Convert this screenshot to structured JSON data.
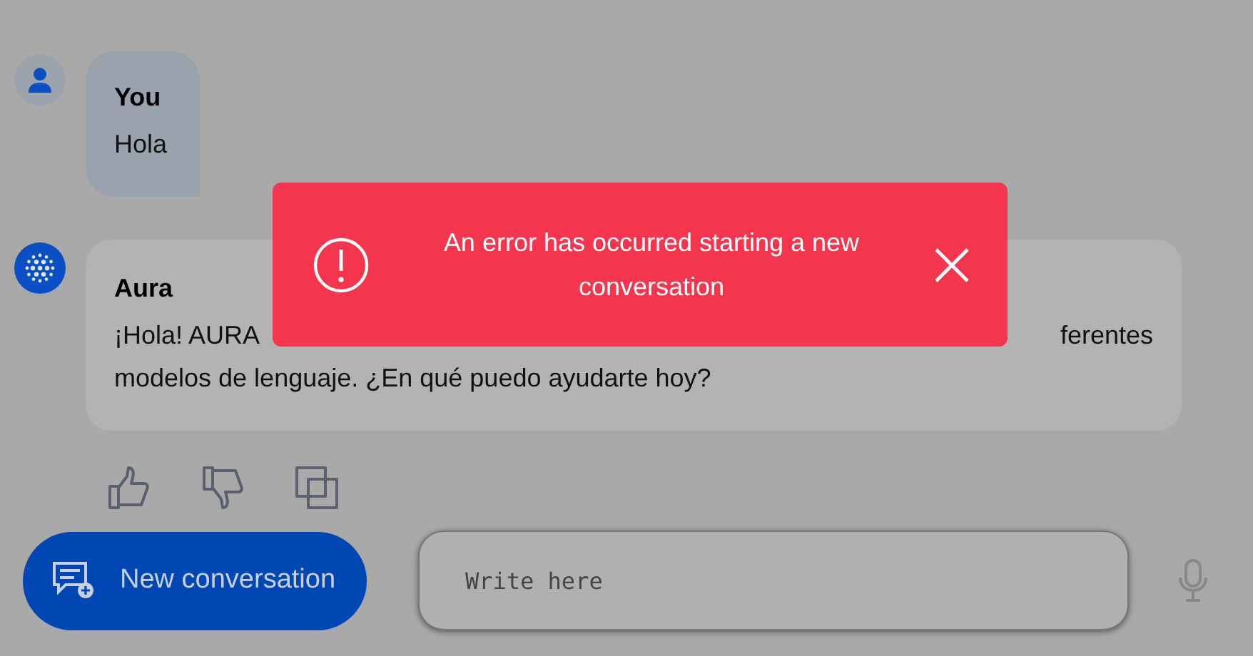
{
  "messages": [
    {
      "kind": "user",
      "author": "You",
      "lines": [
        {
          "start": "Hola"
        }
      ]
    },
    {
      "kind": "bot",
      "author": "Aura",
      "lines": [
        {
          "start": "¡Hola! AURA",
          "end": "ferentes"
        },
        {
          "start": "modelos de lenguaje. ¿En qué puedo ayudarte hoy?"
        }
      ]
    }
  ],
  "toast": {
    "message": "An error has occurred starting a new conversation"
  },
  "new_conversation": {
    "label": "New conversation"
  },
  "composer": {
    "placeholder": "Write here"
  }
}
